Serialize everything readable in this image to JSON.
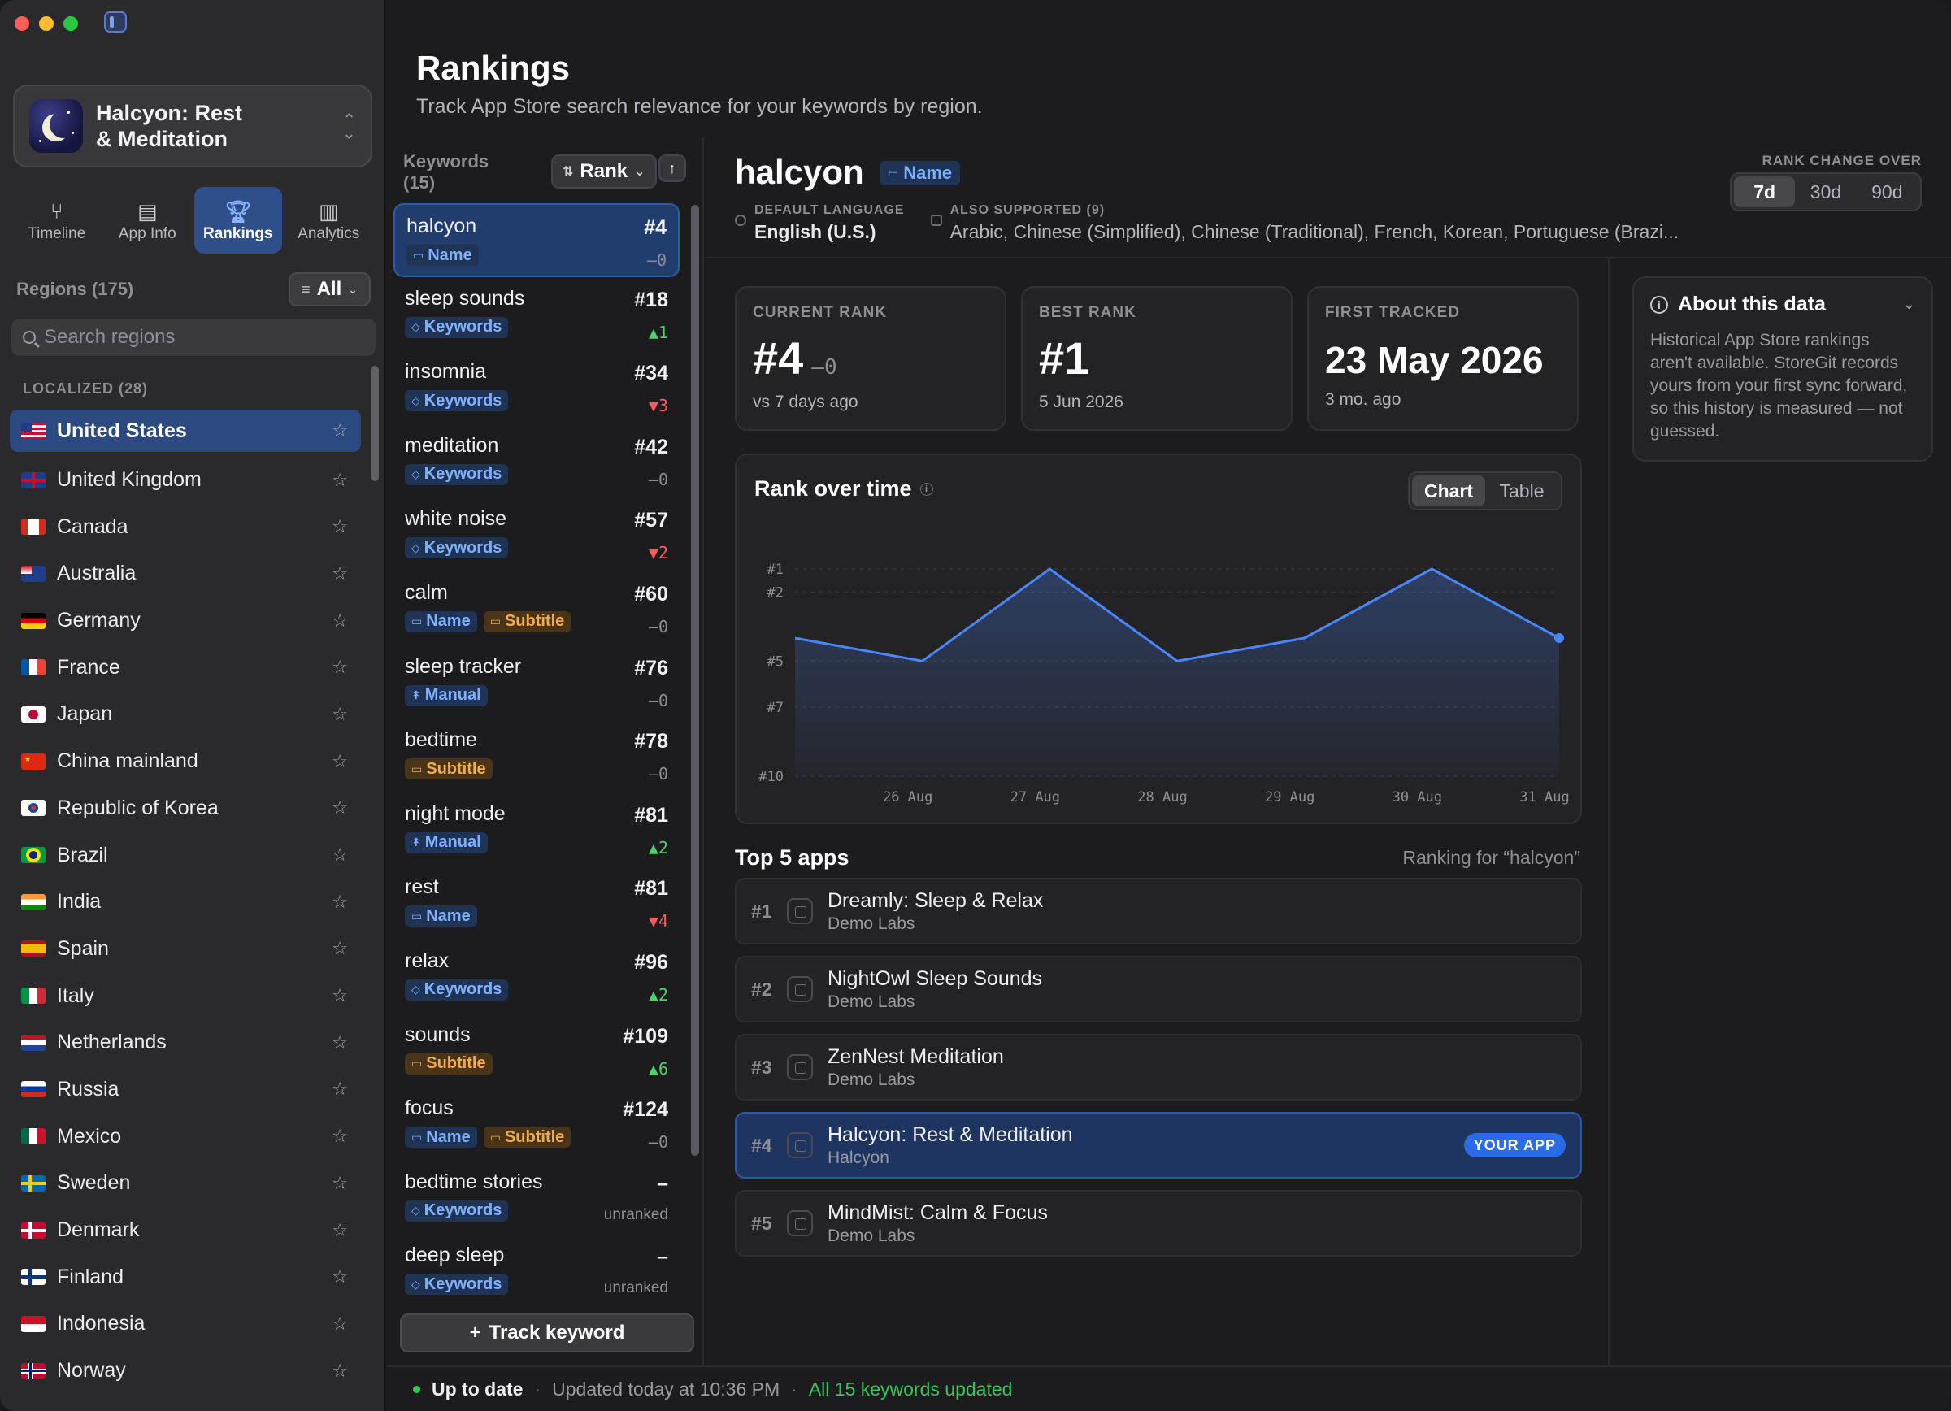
{
  "app": {
    "name": "Halcyon: Rest\n& Meditation",
    "name_line1": "Halcyon: Rest",
    "name_line2": "& Meditation"
  },
  "nav": [
    {
      "label": "Timeline",
      "icon": "fork-icon"
    },
    {
      "label": "App Info",
      "icon": "info-card-icon"
    },
    {
      "label": "Rankings",
      "icon": "trophy-icon",
      "active": true
    },
    {
      "label": "Analytics",
      "icon": "bar-chart-icon"
    }
  ],
  "regions": {
    "title": "Regions (175)",
    "filter": "All",
    "search_placeholder": "Search regions",
    "section": "LOCALIZED (28)",
    "items": [
      {
        "name": "United States",
        "active": true
      },
      {
        "name": "United Kingdom"
      },
      {
        "name": "Canada"
      },
      {
        "name": "Australia"
      },
      {
        "name": "Germany"
      },
      {
        "name": "France"
      },
      {
        "name": "Japan"
      },
      {
        "name": "China mainland"
      },
      {
        "name": "Republic of Korea"
      },
      {
        "name": "Brazil"
      },
      {
        "name": "India"
      },
      {
        "name": "Spain"
      },
      {
        "name": "Italy"
      },
      {
        "name": "Netherlands"
      },
      {
        "name": "Russia"
      },
      {
        "name": "Mexico"
      },
      {
        "name": "Sweden"
      },
      {
        "name": "Denmark"
      },
      {
        "name": "Finland"
      },
      {
        "name": "Indonesia"
      },
      {
        "name": "Norway"
      }
    ]
  },
  "page": {
    "title": "Rankings",
    "subtitle": "Track App Store search relevance for your keywords by region."
  },
  "keywords": {
    "title": "Keywords (15)",
    "sort_label": "Rank",
    "sort_direction": "↑",
    "track_button": "Track keyword",
    "items": [
      {
        "name": "halcyon",
        "rank": "#4",
        "delta": "–0",
        "dir": "flat",
        "tags": [
          "Name"
        ],
        "active": true
      },
      {
        "name": "sleep sounds",
        "rank": "#18",
        "delta": "▲1",
        "dir": "up",
        "tags": [
          "Keywords"
        ]
      },
      {
        "name": "insomnia",
        "rank": "#34",
        "delta": "▼3",
        "dir": "down",
        "tags": [
          "Keywords"
        ]
      },
      {
        "name": "meditation",
        "rank": "#42",
        "delta": "–0",
        "dir": "flat",
        "tags": [
          "Keywords"
        ]
      },
      {
        "name": "white noise",
        "rank": "#57",
        "delta": "▼2",
        "dir": "down",
        "tags": [
          "Keywords"
        ]
      },
      {
        "name": "calm",
        "rank": "#60",
        "delta": "–0",
        "dir": "flat",
        "tags": [
          "Name",
          "Subtitle"
        ]
      },
      {
        "name": "sleep tracker",
        "rank": "#76",
        "delta": "–0",
        "dir": "flat",
        "tags": [
          "Manual"
        ]
      },
      {
        "name": "bedtime",
        "rank": "#78",
        "delta": "–0",
        "dir": "flat",
        "tags": [
          "Subtitle"
        ]
      },
      {
        "name": "night mode",
        "rank": "#81",
        "delta": "▲2",
        "dir": "up",
        "tags": [
          "Manual"
        ]
      },
      {
        "name": "rest",
        "rank": "#81",
        "delta": "▼4",
        "dir": "down",
        "tags": [
          "Name"
        ]
      },
      {
        "name": "relax",
        "rank": "#96",
        "delta": "▲2",
        "dir": "up",
        "tags": [
          "Keywords"
        ]
      },
      {
        "name": "sounds",
        "rank": "#109",
        "delta": "▲6",
        "dir": "up",
        "tags": [
          "Subtitle"
        ]
      },
      {
        "name": "focus",
        "rank": "#124",
        "delta": "–0",
        "dir": "flat",
        "tags": [
          "Name",
          "Subtitle"
        ]
      },
      {
        "name": "bedtime stories",
        "rank": "–",
        "delta": "unranked",
        "dir": "none",
        "tags": [
          "Keywords"
        ]
      },
      {
        "name": "deep sleep",
        "rank": "–",
        "delta": "unranked",
        "dir": "none",
        "tags": [
          "Keywords"
        ]
      }
    ]
  },
  "detail": {
    "keyword": "halcyon",
    "badge": "Name",
    "default_language_label": "DEFAULT LANGUAGE",
    "default_language": "English (U.S.)",
    "also_supported_label": "ALSO SUPPORTED (9)",
    "also_supported": "Arabic, Chinese (Simplified), Chinese (Traditional), French, Korean, Portuguese (Brazi...",
    "range_label": "RANK CHANGE OVER",
    "ranges": [
      "7d",
      "30d",
      "90d"
    ],
    "range_selected": "7d",
    "stats": {
      "current_label": "CURRENT RANK",
      "current_value": "#4",
      "current_delta": "–0",
      "current_sub": "vs 7 days ago",
      "best_label": "BEST RANK",
      "best_value": "#1",
      "best_sub": "5 Jun 2026",
      "first_label": "FIRST TRACKED",
      "first_value": "23 May 2026",
      "first_sub": "3 mo. ago"
    },
    "chart_title": "Rank over time",
    "chart_tabs": [
      "Chart",
      "Table"
    ],
    "chart_tab_selected": "Chart",
    "top5_title": "Top 5 apps",
    "top5_meta": "Ranking for “halcyon”",
    "top5": [
      {
        "pos": "#1",
        "name": "Dreamly: Sleep & Relax",
        "dev": "Demo Labs"
      },
      {
        "pos": "#2",
        "name": "NightOwl Sleep Sounds",
        "dev": "Demo Labs"
      },
      {
        "pos": "#3",
        "name": "ZenNest Meditation",
        "dev": "Demo Labs"
      },
      {
        "pos": "#4",
        "name": "Halcyon: Rest & Meditation",
        "dev": "Halcyon",
        "mine": true,
        "badge": "YOUR APP"
      },
      {
        "pos": "#5",
        "name": "MindMist: Calm & Focus",
        "dev": "Demo Labs"
      }
    ],
    "about": {
      "title": "About this data",
      "text": "Historical App Store rankings aren't available. StoreGit records yours from your first sync forward, so this history is measured — not guessed."
    }
  },
  "chart_data": {
    "type": "area",
    "title": "Rank over time",
    "x": [
      "25 Aug",
      "26 Aug",
      "26.5 Aug",
      "27 Aug",
      "28 Aug",
      "29 Aug",
      "30 Aug",
      "31 Aug"
    ],
    "tick_labels_x": [
      "26 Aug",
      "27 Aug",
      "28 Aug",
      "29 Aug",
      "30 Aug",
      "31 Aug"
    ],
    "tick_labels_y": [
      "#1",
      "#2",
      "#5",
      "#7",
      "#10"
    ],
    "points": [
      {
        "x": "25 Aug",
        "y": 4
      },
      {
        "x": "26 Aug",
        "y": 5
      },
      {
        "x": "27 Aug",
        "y": 1
      },
      {
        "x": "28 Aug",
        "y": 5
      },
      {
        "x": "29 Aug",
        "y": 4
      },
      {
        "x": "30 Aug",
        "y": 1
      },
      {
        "x": "31 Aug",
        "y": 4
      }
    ],
    "y_axis_inverted": true,
    "ylim": [
      1,
      10
    ],
    "grid": true,
    "color": "#4a86ff"
  },
  "status": {
    "state": "Up to date",
    "updated": "Updated today at 10:36 PM",
    "summary": "All 15 keywords updated"
  }
}
